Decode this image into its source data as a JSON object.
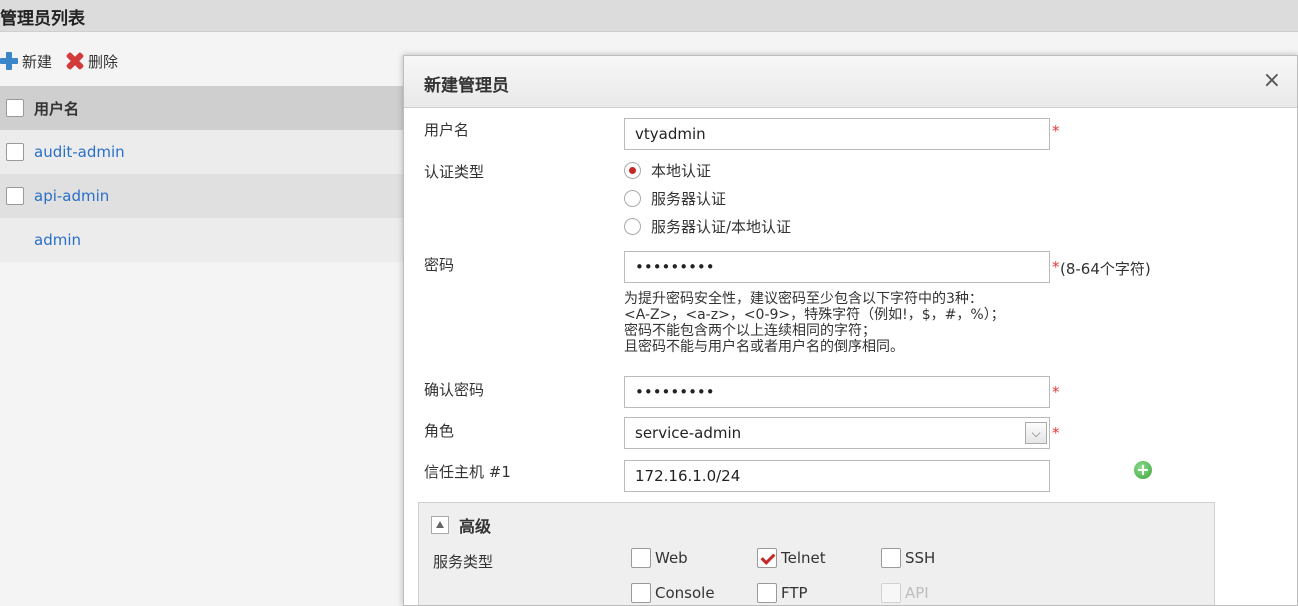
{
  "list": {
    "title": "管理员列表",
    "toolbar": {
      "new_label": "新建",
      "delete_label": "删除"
    },
    "column_header": "用户名",
    "rows": [
      {
        "name": "audit-admin",
        "has_checkbox": true
      },
      {
        "name": "api-admin",
        "has_checkbox": true
      },
      {
        "name": "admin",
        "has_checkbox": false
      }
    ]
  },
  "modal": {
    "title": "新建管理员",
    "close_glyph": "×",
    "username": {
      "label": "用户名",
      "value": "vtyadmin",
      "required": "*"
    },
    "auth_type": {
      "label": "认证类型",
      "options": [
        "本地认证",
        "服务器认证",
        "服务器认证/本地认证"
      ],
      "selected": "本地认证"
    },
    "password": {
      "label": "密码",
      "value": "•••••••••",
      "required": "*",
      "hint": "(8-64个字符)"
    },
    "password_hint_lines": [
      "为提升密码安全性，建议密码至少包含以下字符中的3种：",
      "<A-Z>，<a-z>，<0-9>，特殊字符（例如!，$，#，%）；",
      "密码不能包含两个以上连续相同的字符；",
      "且密码不能与用户名或者用户名的倒序相同。"
    ],
    "confirm_password": {
      "label": "确认密码",
      "value": "•••••••••",
      "required": "*"
    },
    "role": {
      "label": "角色",
      "value": "service-admin",
      "required": "*"
    },
    "trusted_host": {
      "label": "信任主机 #1",
      "value": "172.16.1.0/24"
    },
    "advanced": {
      "title": "高级",
      "service_type_label": "服务类型",
      "services": [
        {
          "name": "Web",
          "checked": false,
          "disabled": false
        },
        {
          "name": "Telnet",
          "checked": true,
          "disabled": false
        },
        {
          "name": "SSH",
          "checked": false,
          "disabled": false
        },
        {
          "name": "Console",
          "checked": false,
          "disabled": false
        },
        {
          "name": "FTP",
          "checked": false,
          "disabled": false
        },
        {
          "name": "API",
          "checked": false,
          "disabled": true
        }
      ]
    }
  },
  "colors": {
    "link": "#2a6fc7",
    "required": "#e53935",
    "radio_on": "#c62828",
    "check": "#c62828"
  }
}
